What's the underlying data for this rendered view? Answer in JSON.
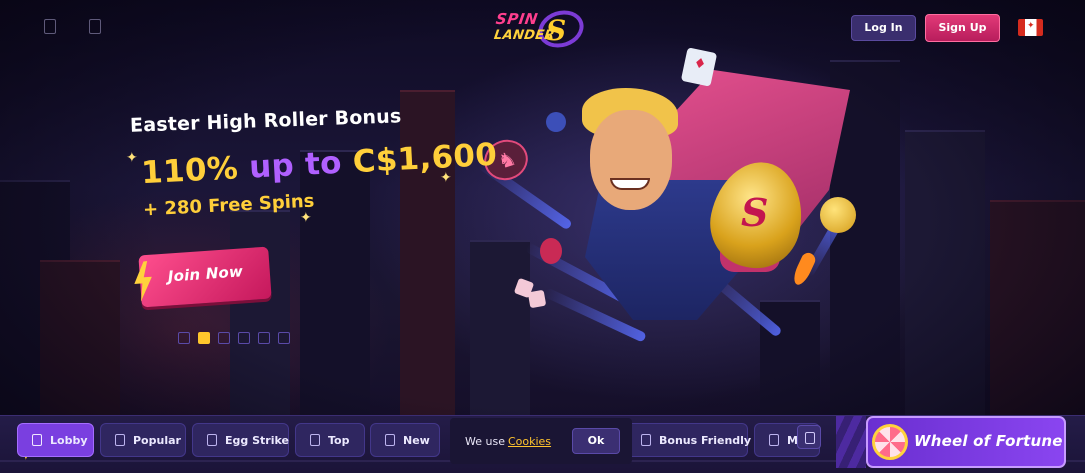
{
  "header": {
    "login_label": "Log In",
    "signup_label": "Sign Up",
    "logo_line_1": "SPIN",
    "logo_line_2": "LANDER",
    "logo_mark": "S",
    "icons": [
      "menu-icon",
      "search-icon"
    ],
    "flag": "canada-flag"
  },
  "promo": {
    "title": "Easter High Roller Bonus",
    "amount_part_1": "110%",
    "amount_part_2": "up to",
    "amount_part_3": "C$1,600",
    "free_spins": "+ 280 Free Spins",
    "cta_label": "Join Now",
    "slides_total": 6,
    "slide_active": 2
  },
  "categories": [
    {
      "label": "Lobby",
      "active": true
    },
    {
      "label": "Popular",
      "active": false
    },
    {
      "label": "Egg Strike",
      "active": false
    },
    {
      "label": "Top",
      "active": false
    },
    {
      "label": "New",
      "active": false
    },
    {
      "label": "Bonus Friendly",
      "active": false
    },
    {
      "label": "M",
      "active": false
    }
  ],
  "cookie": {
    "text": "We use",
    "link_label": "Cookies",
    "ok_label": "Ok"
  },
  "wheel_of_fortune": {
    "label": "Wheel of Fortune"
  },
  "colors": {
    "accent_yellow": "#ffcf3a",
    "accent_purple": "#b060ff",
    "accent_pink": "#e23a78",
    "active_tab": "#7a3fe0",
    "background": "#120d28"
  }
}
